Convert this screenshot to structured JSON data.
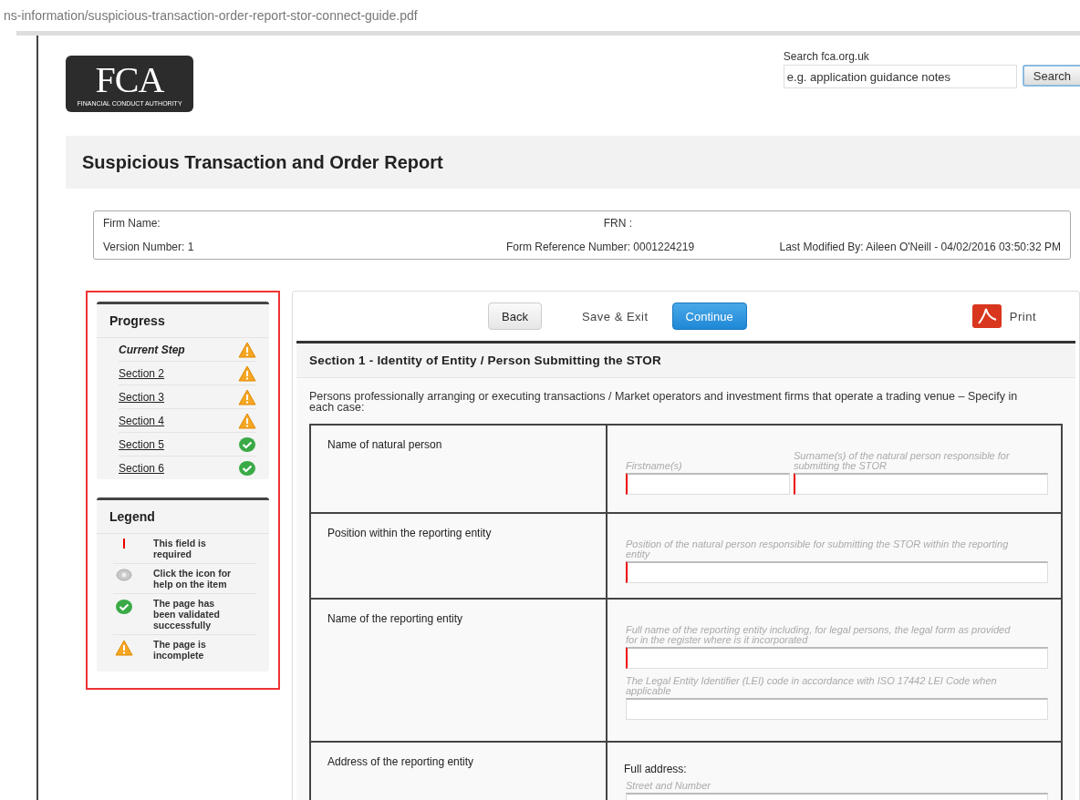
{
  "url": "ns-information/suspicious-transaction-order-report-stor-connect-guide.pdf",
  "logo": {
    "mark": "FCA",
    "subtitle": "FINANCIAL CONDUCT AUTHORITY"
  },
  "search": {
    "label": "Search fca.org.uk",
    "value": "e.g. application guidance notes",
    "button": "Search"
  },
  "title": "Suspicious Transaction and Order Report",
  "info": {
    "firm_name": "Firm Name:",
    "frn": "FRN :",
    "version": "Version Number: 1",
    "form_reference": "Form Reference Number: 0001224219",
    "last_modified": "Last Modified By: Aileen O'Neill - 04/02/2016 03:50:32 PM"
  },
  "progress": {
    "title": "Progress",
    "items": [
      {
        "label": "Current Step",
        "selected": true,
        "kind": "warning"
      },
      {
        "label": "Section 2",
        "selected": false,
        "kind": "warning"
      },
      {
        "label": "Section 3",
        "selected": false,
        "kind": "warning"
      },
      {
        "label": "Section 4",
        "selected": false,
        "kind": "warning"
      },
      {
        "label": "Section 5",
        "selected": false,
        "kind": "ok"
      },
      {
        "label": "Section 6",
        "selected": false,
        "kind": "ok"
      }
    ]
  },
  "legend": {
    "title": "Legend",
    "items": [
      {
        "kind": "required",
        "text": "This field is required"
      },
      {
        "kind": "help",
        "text": "Click the icon for help on the item"
      },
      {
        "kind": "ok",
        "text": "The page has been validated successfully"
      },
      {
        "kind": "warning",
        "text": "The page is incomplete"
      }
    ]
  },
  "toolbar": {
    "back": "Back",
    "save_exit": "Save & Exit",
    "continue": "Continue",
    "print": "Print"
  },
  "section": {
    "heading": "Section 1 - Identity of Entity / Person Submitting the STOR",
    "intro": "Persons professionally arranging or executing transactions / Market operators and investment firms that operate a trading venue – Specify in each case:",
    "rows": [
      {
        "label": "Name of natural person",
        "lines": [
          [
            {
              "hint": "Firstname(s)",
              "required": true
            },
            {
              "hint": "Surname(s) of the natural person responsible for submitting the STOR",
              "required": true
            }
          ]
        ]
      },
      {
        "label": "Position within the reporting entity",
        "lines": [
          [
            {
              "hint": "Position of the natural person responsible for submitting the STOR within the reporting entity",
              "required": true
            }
          ]
        ]
      },
      {
        "label": "Name of the reporting entity",
        "lines": [
          [
            {
              "hint": "Full name of the reporting entity including, for legal persons, the legal form as provided for in the register where is it incorporated",
              "required": true
            }
          ],
          [
            {
              "hint": "The Legal Entity Identifier (LEI) code in accordance with ISO 17442 LEI Code when applicable",
              "required": false
            }
          ]
        ]
      },
      {
        "label": "Address of the reporting entity",
        "heading": "Full address:",
        "lines": [
          [
            {
              "hint": "Street and Number"
            }
          ]
        ]
      }
    ]
  }
}
